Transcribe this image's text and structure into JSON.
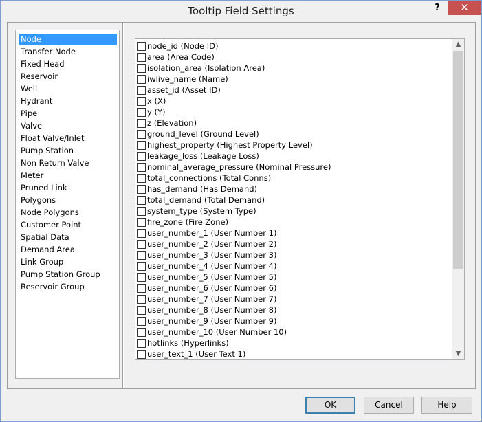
{
  "window": {
    "title": "Tooltip Field Settings",
    "help_glyph": "?",
    "close_glyph": "✕"
  },
  "categories": [
    {
      "label": "Node",
      "selected": true
    },
    {
      "label": "Transfer Node"
    },
    {
      "label": "Fixed Head"
    },
    {
      "label": "Reservoir"
    },
    {
      "label": "Well"
    },
    {
      "label": "Hydrant"
    },
    {
      "label": "Pipe"
    },
    {
      "label": "Valve"
    },
    {
      "label": "Float Valve/Inlet"
    },
    {
      "label": "Pump Station"
    },
    {
      "label": "Non Return Valve"
    },
    {
      "label": "Meter"
    },
    {
      "label": "Pruned Link"
    },
    {
      "label": "Polygons"
    },
    {
      "label": "Node Polygons"
    },
    {
      "label": "Customer Point"
    },
    {
      "label": "Spatial Data"
    },
    {
      "label": "Demand Area"
    },
    {
      "label": "Link Group"
    },
    {
      "label": "Pump Station Group"
    },
    {
      "label": "Reservoir Group"
    }
  ],
  "fields": [
    {
      "label": "node_id (Node ID)",
      "checked": false
    },
    {
      "label": "area (Area Code)",
      "checked": false
    },
    {
      "label": "isolation_area (Isolation Area)",
      "checked": false
    },
    {
      "label": "iwlive_name (Name)",
      "checked": false
    },
    {
      "label": "asset_id (Asset ID)",
      "checked": false
    },
    {
      "label": "x (X)",
      "checked": false
    },
    {
      "label": "y (Y)",
      "checked": false
    },
    {
      "label": "z (Elevation)",
      "checked": false
    },
    {
      "label": "ground_level (Ground Level)",
      "checked": false
    },
    {
      "label": "highest_property (Highest Property Level)",
      "checked": false
    },
    {
      "label": "leakage_loss (Leakage Loss)",
      "checked": false
    },
    {
      "label": "nominal_average_pressure (Nominal Pressure)",
      "checked": false
    },
    {
      "label": "total_connections (Total Conns)",
      "checked": false
    },
    {
      "label": "has_demand (Has Demand)",
      "checked": false
    },
    {
      "label": "total_demand (Total Demand)",
      "checked": false
    },
    {
      "label": "system_type (System Type)",
      "checked": false
    },
    {
      "label": "fire_zone (Fire Zone)",
      "checked": false
    },
    {
      "label": "user_number_1 (User Number 1)",
      "checked": false
    },
    {
      "label": "user_number_2 (User Number 2)",
      "checked": false
    },
    {
      "label": "user_number_3 (User Number 3)",
      "checked": false
    },
    {
      "label": "user_number_4 (User Number 4)",
      "checked": false
    },
    {
      "label": "user_number_5 (User Number 5)",
      "checked": false
    },
    {
      "label": "user_number_6 (User Number 6)",
      "checked": false
    },
    {
      "label": "user_number_7 (User Number 7)",
      "checked": false
    },
    {
      "label": "user_number_8 (User Number 8)",
      "checked": false
    },
    {
      "label": "user_number_9 (User Number 9)",
      "checked": false
    },
    {
      "label": "user_number_10 (User Number 10)",
      "checked": false
    },
    {
      "label": "hotlinks (Hyperlinks)",
      "checked": false
    },
    {
      "label": "user_text_1 (User Text 1)",
      "checked": false
    }
  ],
  "buttons": {
    "ok": "OK",
    "cancel": "Cancel",
    "help": "Help"
  },
  "colors": {
    "selection": "#3399ff",
    "close": "#c75050"
  }
}
